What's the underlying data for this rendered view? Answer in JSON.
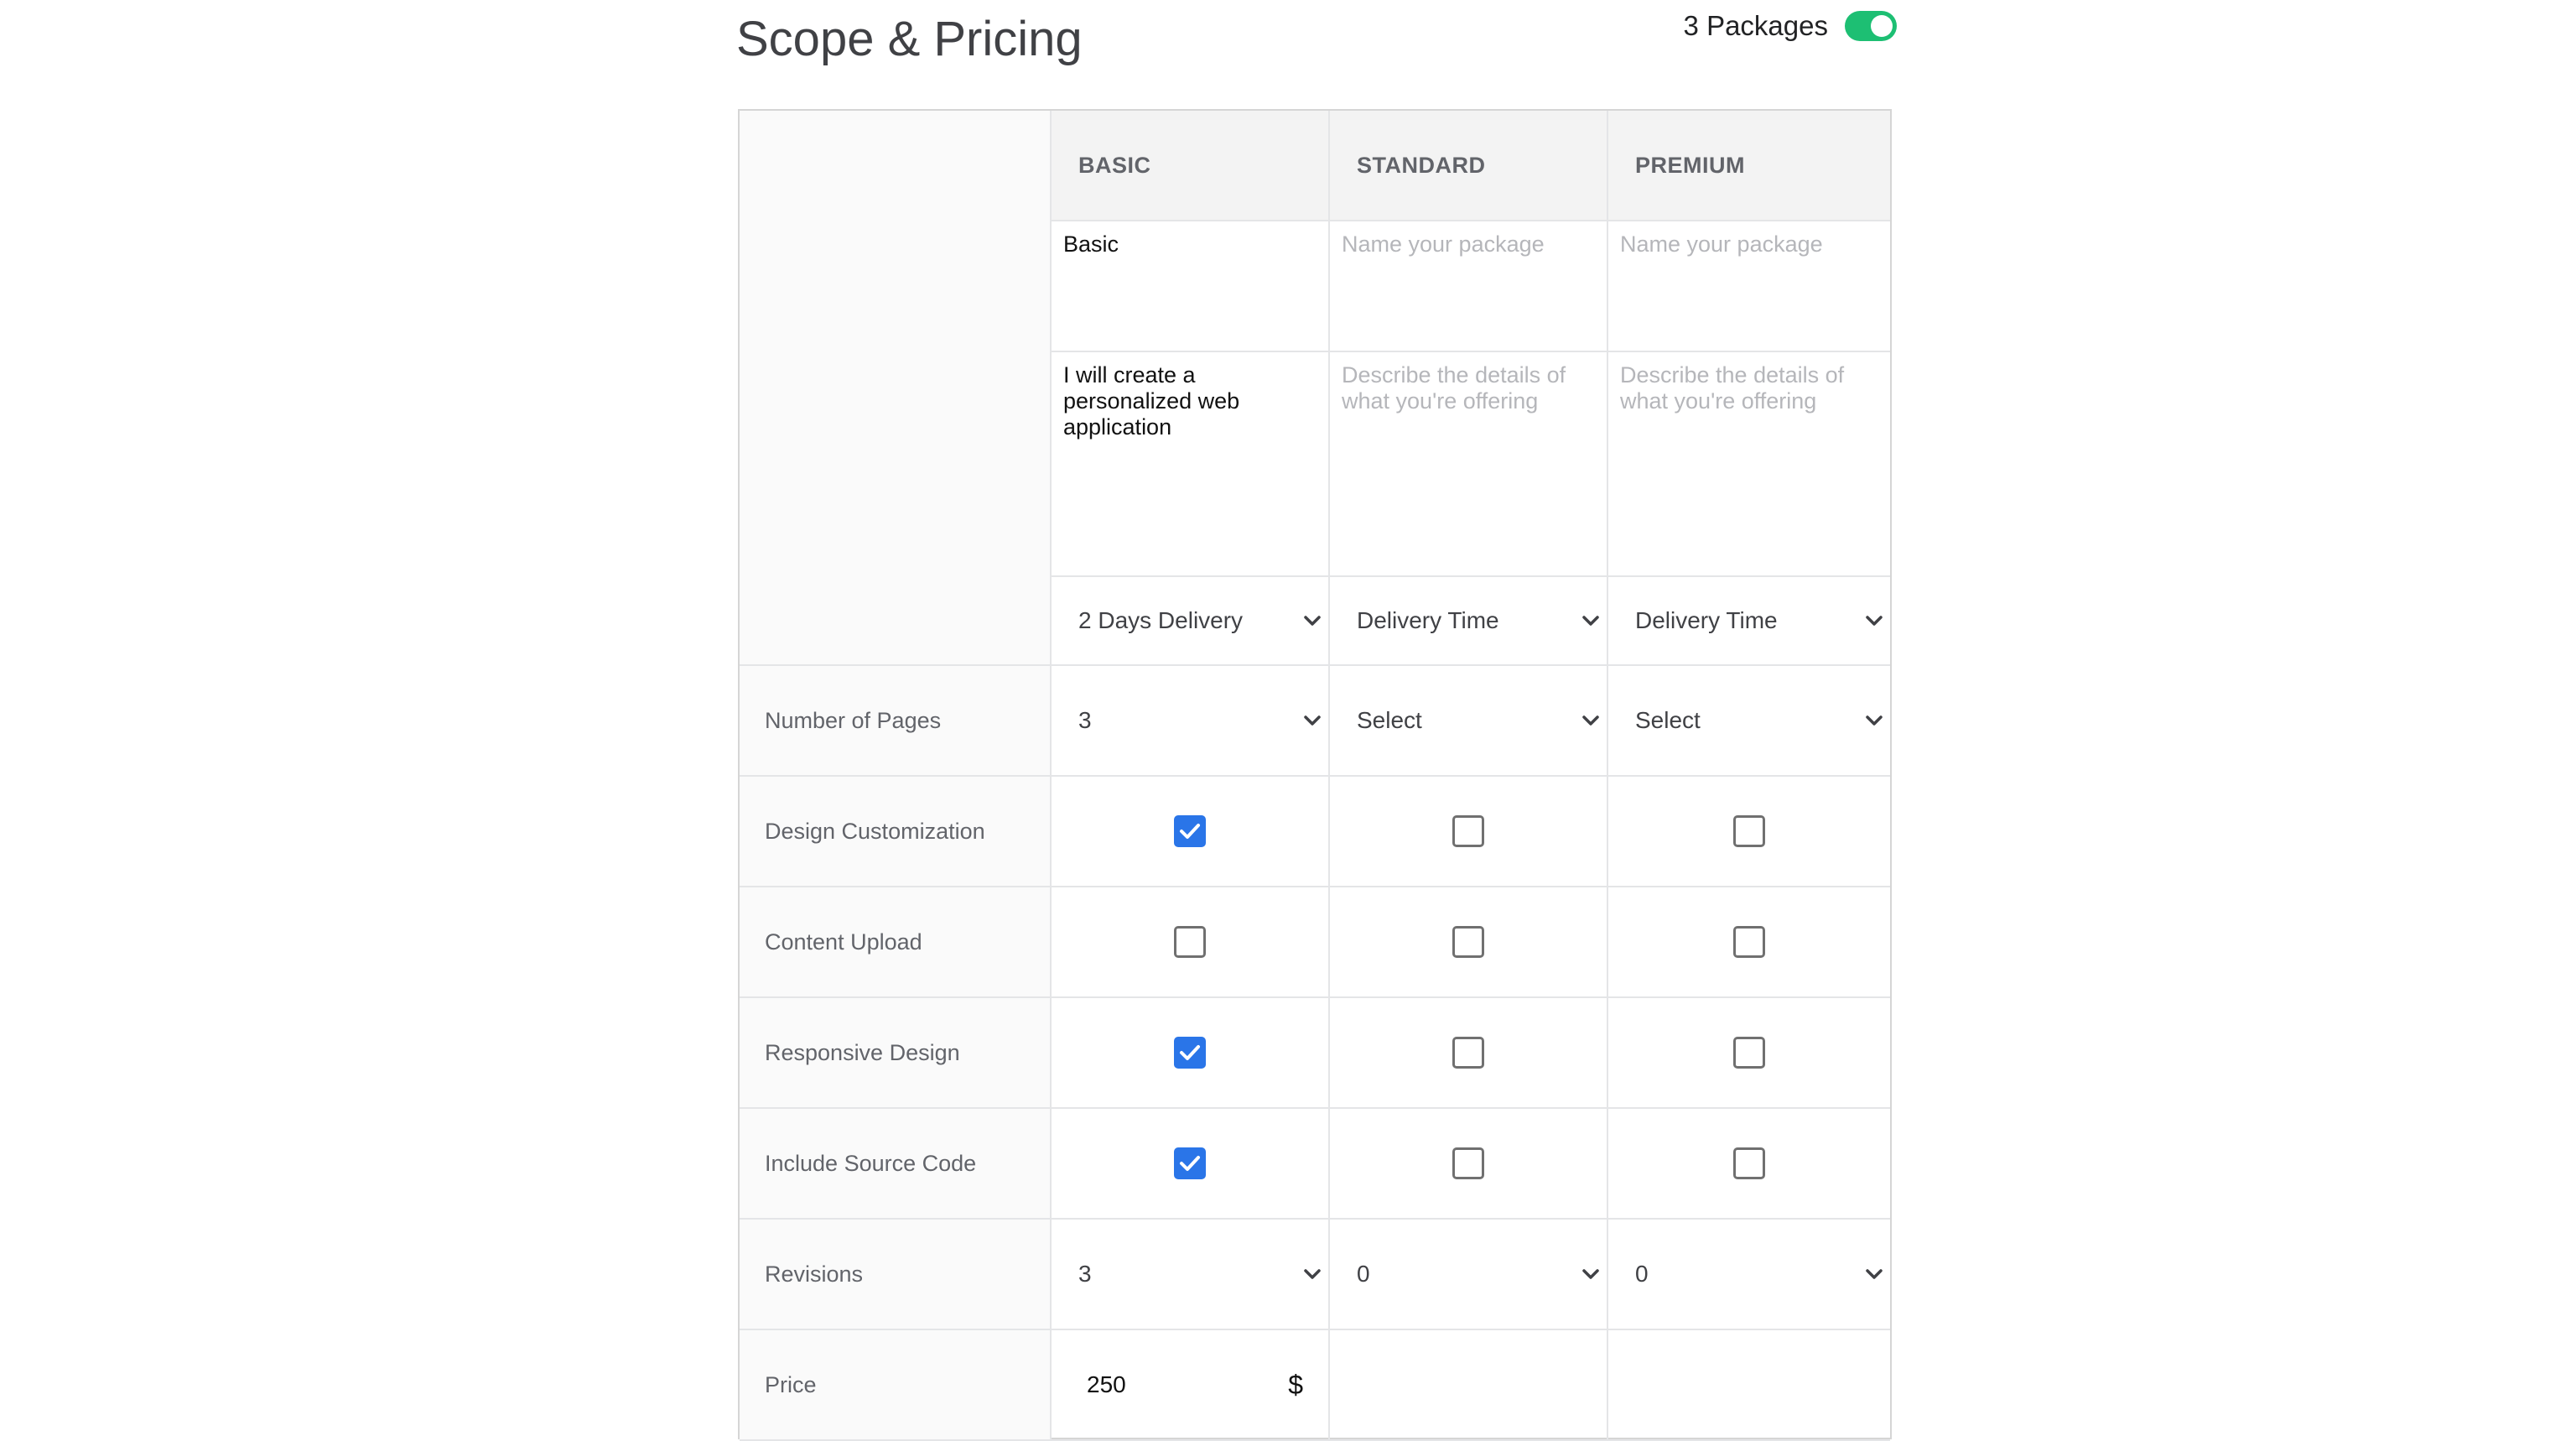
{
  "title": "Scope & Pricing",
  "packages_toggle": {
    "label": "3 Packages",
    "on": true,
    "color": "#1dbf73"
  },
  "columns": [
    "BASIC",
    "STANDARD",
    "PREMIUM"
  ],
  "name_row": {
    "values": [
      "Basic",
      "",
      ""
    ],
    "placeholder": "Name your package"
  },
  "desc_row": {
    "values": [
      "I will create a personalized web application",
      "",
      ""
    ],
    "placeholder": "Describe the details of what you're offering"
  },
  "delivery_row": [
    "2 Days Delivery",
    "Delivery Time",
    "Delivery Time"
  ],
  "rows": [
    {
      "label": "Number of Pages",
      "type": "select",
      "values": [
        "3",
        "Select",
        "Select"
      ]
    },
    {
      "label": "Design Customization",
      "type": "checkbox",
      "values": [
        true,
        false,
        false
      ]
    },
    {
      "label": "Content Upload",
      "type": "checkbox",
      "values": [
        false,
        false,
        false
      ]
    },
    {
      "label": "Responsive Design",
      "type": "checkbox",
      "values": [
        true,
        false,
        false
      ]
    },
    {
      "label": "Include Source Code",
      "type": "checkbox",
      "values": [
        true,
        false,
        false
      ]
    },
    {
      "label": "Revisions",
      "type": "select",
      "values": [
        "3",
        "0",
        "0"
      ]
    },
    {
      "label": "Price",
      "type": "price",
      "values": [
        "250",
        "",
        ""
      ],
      "currency": "$"
    }
  ],
  "colors": {
    "checkbox_on": "#2a75e8",
    "header_bg": "#f3f3f3",
    "side_bg": "#fafafa"
  }
}
